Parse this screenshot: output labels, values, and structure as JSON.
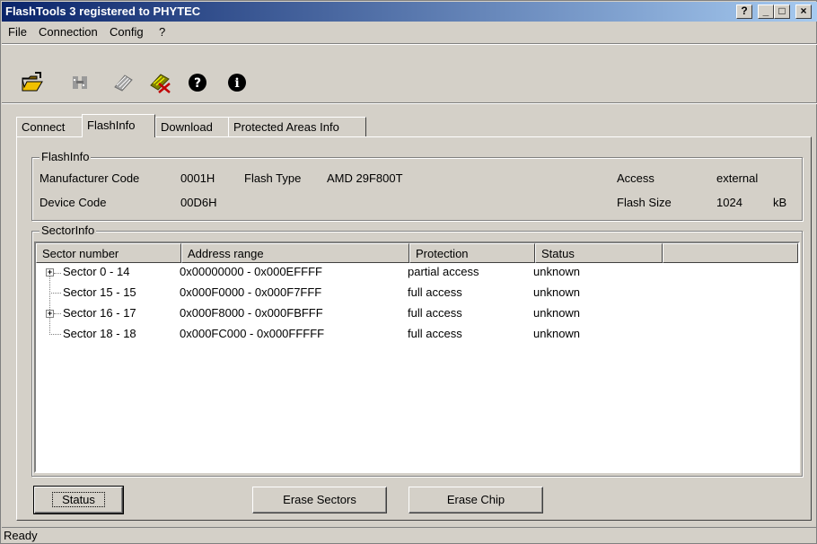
{
  "window": {
    "title": "FlashTools 3  registered to PHYTEC",
    "caption_buttons": [
      "?",
      "_",
      "□",
      "×"
    ]
  },
  "menu": [
    "File",
    "Connection",
    "Config",
    "?"
  ],
  "toolbar": {
    "icons": [
      "open-folder-icon",
      "connect-icon",
      "chip-icon",
      "erase-chip-icon",
      "help-icon",
      "info-icon"
    ],
    "colors": {
      "folder": "#f0c000",
      "help_bg": "#000000"
    }
  },
  "tabs": [
    "Connect",
    "FlashInfo",
    "Download",
    "Protected Areas Info"
  ],
  "active_tab": "FlashInfo",
  "flashinfo": {
    "legend": "FlashInfo",
    "manufacturer_label": "Manufacturer Code",
    "manufacturer_value": "0001H",
    "flash_type_label": "Flash Type",
    "flash_type_value": "AMD 29F800T",
    "access_label": "Access",
    "access_value": "external",
    "device_label": "Device Code",
    "device_value": "00D6H",
    "size_label": "Flash Size",
    "size_value": "1024",
    "size_unit": "kB"
  },
  "sectorinfo": {
    "legend": "SectorInfo",
    "columns": [
      "Sector number",
      "Address range",
      "Protection",
      "Status"
    ],
    "rows": [
      {
        "sector": "Sector 0 - 14",
        "range": "0x00000000 - 0x000EFFFF",
        "protection": "partial access",
        "status": "unknown",
        "expandable": true
      },
      {
        "sector": "Sector 15 - 15",
        "range": "0x000F0000 - 0x000F7FFF",
        "protection": "full access",
        "status": "unknown",
        "expandable": false
      },
      {
        "sector": "Sector 16 - 17",
        "range": "0x000F8000 - 0x000FBFFF",
        "protection": "full access",
        "status": "unknown",
        "expandable": true
      },
      {
        "sector": "Sector 18 - 18",
        "range": "0x000FC000 - 0x000FFFFF",
        "protection": "full access",
        "status": "unknown",
        "expandable": false
      }
    ]
  },
  "buttons": {
    "status": "Status",
    "erase_sectors": "Erase Sectors",
    "erase_chip": "Erase Chip"
  },
  "statusbar": {
    "text": "Ready"
  }
}
